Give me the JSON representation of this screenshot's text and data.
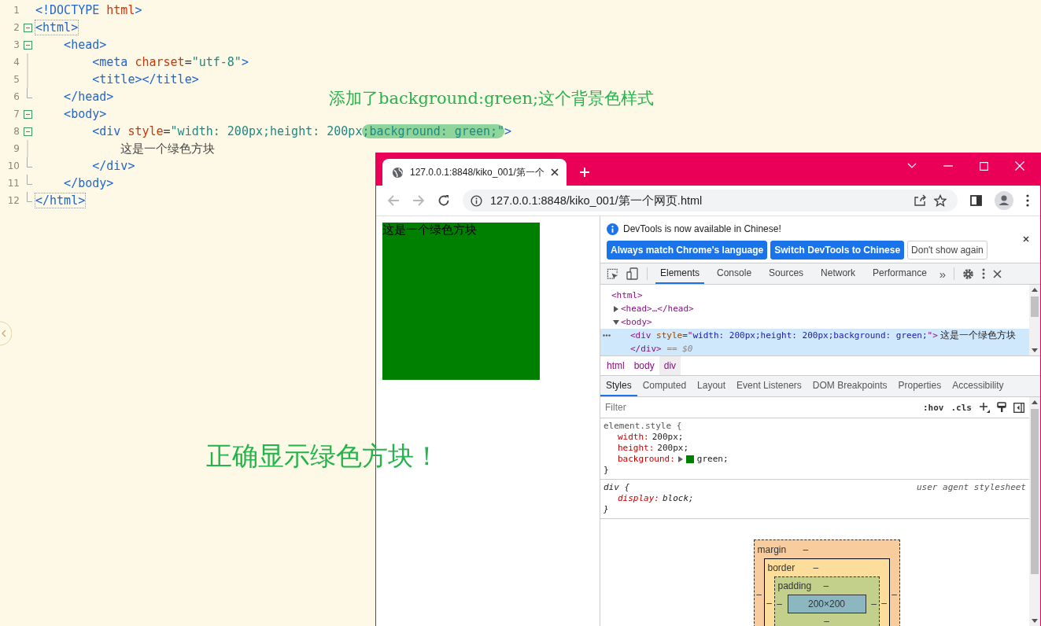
{
  "editor": {
    "lines": [
      {
        "number": "1",
        "kind": "none",
        "tokens": [
          {
            "text": "<!DOCTYPE ",
            "kind": "tag"
          },
          {
            "text": "html",
            "kind": "attr"
          },
          {
            "text": ">",
            "kind": "tag"
          }
        ]
      },
      {
        "number": "2",
        "kind": "start",
        "tokens": [
          {
            "text": "<html>",
            "kind": "tag-matched"
          }
        ]
      },
      {
        "number": "3",
        "kind": "start",
        "tokens": [
          {
            "text": "    <head>",
            "kind": "tag"
          }
        ]
      },
      {
        "number": "4",
        "kind": "inside",
        "tokens": [
          {
            "text": "        <meta",
            "kind": "tag"
          },
          {
            "text": " charset",
            "kind": "attr"
          },
          {
            "text": "=",
            "kind": "plain"
          },
          {
            "text": "\"utf-8\"",
            "kind": "string"
          },
          {
            "text": ">",
            "kind": "tag"
          }
        ]
      },
      {
        "number": "5",
        "kind": "inside",
        "tokens": [
          {
            "text": "        <title></title>",
            "kind": "tag"
          }
        ]
      },
      {
        "number": "6",
        "kind": "end",
        "tokens": [
          {
            "text": "    </head>",
            "kind": "tag"
          }
        ]
      },
      {
        "number": "7",
        "kind": "start",
        "tokens": [
          {
            "text": "    <body>",
            "kind": "tag"
          }
        ]
      },
      {
        "number": "8",
        "kind": "start",
        "tokens": [
          {
            "text": "        <div",
            "kind": "tag"
          },
          {
            "text": " style",
            "kind": "attr"
          },
          {
            "text": "=",
            "kind": "plain"
          },
          {
            "text": "\"width: 200px;height: 200px",
            "kind": "string"
          },
          {
            "text": ";background: green;\"",
            "kind": "string-marked"
          },
          {
            "text": ">",
            "kind": "tag"
          }
        ]
      },
      {
        "number": "9",
        "kind": "inside",
        "tokens": [
          {
            "text": "            这是一个绿色方块",
            "kind": "text"
          }
        ]
      },
      {
        "number": "10",
        "kind": "end",
        "tokens": [
          {
            "text": "        </div>",
            "kind": "tag"
          }
        ]
      },
      {
        "number": "11",
        "kind": "end",
        "tokens": [
          {
            "text": "    </body>",
            "kind": "tag"
          }
        ]
      },
      {
        "number": "12",
        "kind": "end",
        "tokens": [
          {
            "text": "</html>",
            "kind": "tag-matched"
          }
        ]
      }
    ]
  },
  "annotations": [
    {
      "text": "添加了background:green;这个背景色样式",
      "kind": "note"
    },
    {
      "text": "正确显示绿色方块！",
      "kind": "headline"
    }
  ],
  "browser": {
    "tab": {
      "title": "127.0.0.1:8848/kiko_001/第一个"
    },
    "address": "127.0.0.1:8848/kiko_001/第一个网页.html",
    "page": {
      "box_text": "这是一个绿色方块"
    },
    "devtools": {
      "infobar": {
        "message": "DevTools is now available in Chinese!",
        "buttons": [
          {
            "label": "Always match Chrome's language",
            "kind": "primary"
          },
          {
            "label": "Switch DevTools to Chinese",
            "kind": "primary"
          },
          {
            "label": "Don't show again",
            "kind": "secondary"
          }
        ]
      },
      "panels": [
        {
          "label": "Elements",
          "selected": true
        },
        {
          "label": "Console",
          "selected": false
        },
        {
          "label": "Sources",
          "selected": false
        },
        {
          "label": "Network",
          "selected": false
        },
        {
          "label": "Performance",
          "selected": false
        }
      ],
      "more": "»",
      "dom": [
        {
          "tokens": [
            {
              "text": "<html>",
              "kind": "tag"
            }
          ],
          "selected": false,
          "children": [
            {
              "tokens": [
                {
                  "text": "<head>…</head>",
                  "kind": "tag"
                }
              ],
              "expanded": false,
              "selected": false
            },
            {
              "tokens": [
                {
                  "text": "<body>",
                  "kind": "tag"
                }
              ],
              "expanded": true,
              "selected": false,
              "children": [
                {
                  "tokens": [
                    {
                      "text": "<div",
                      "kind": "tag"
                    },
                    {
                      "text": " style",
                      "kind": "attr"
                    },
                    {
                      "text": "=\"",
                      "kind": "tag"
                    },
                    {
                      "text": "width: 200px;height: 200px;background: green;",
                      "kind": "value"
                    },
                    {
                      "text": "\">",
                      "kind": "tag"
                    },
                    {
                      "text": " 这是一个绿色方块",
                      "kind": "text"
                    }
                  ],
                  "closing": "</div>",
                  "marker": "== $0",
                  "selected": true
                }
              ]
            }
          ]
        }
      ],
      "breadcrumbs": [
        {
          "label": "html",
          "selected": false
        },
        {
          "label": "body",
          "selected": false
        },
        {
          "label": "div",
          "selected": true
        }
      ],
      "sidebar_tabs": [
        {
          "label": "Styles",
          "selected": true
        },
        {
          "label": "Computed",
          "selected": false
        },
        {
          "label": "Layout",
          "selected": false
        },
        {
          "label": "Event Listeners",
          "selected": false
        },
        {
          "label": "DOM Breakpoints",
          "selected": false
        },
        {
          "label": "Properties",
          "selected": false
        },
        {
          "label": "Accessibility",
          "selected": false
        }
      ],
      "filter": {
        "placeholder": "Filter"
      },
      "toggles": [
        ":hov",
        ".cls"
      ],
      "rules": [
        {
          "selector": "element.style {",
          "kind": "inline",
          "declarations": [
            {
              "property": "width:",
              "value": "200px;"
            },
            {
              "property": "height:",
              "value": "200px;"
            },
            {
              "property": "background:",
              "value": "green;",
              "color": "#008000"
            }
          ],
          "close": "}"
        },
        {
          "selector": "div {",
          "kind": "user-agent",
          "source": "user agent stylesheet",
          "declarations": [
            {
              "property": "display:",
              "value": "block;"
            }
          ],
          "close": "}"
        }
      ],
      "box_model": {
        "margin": {
          "label": "margin",
          "top": "–",
          "left": "–",
          "right": "–"
        },
        "border": {
          "label": "border",
          "top": "–",
          "left": "–",
          "right": "–"
        },
        "padding": {
          "label": "padding",
          "top": "–",
          "left": "–",
          "right": "–",
          "bottom": "–"
        },
        "content": "200×200"
      }
    }
  }
}
